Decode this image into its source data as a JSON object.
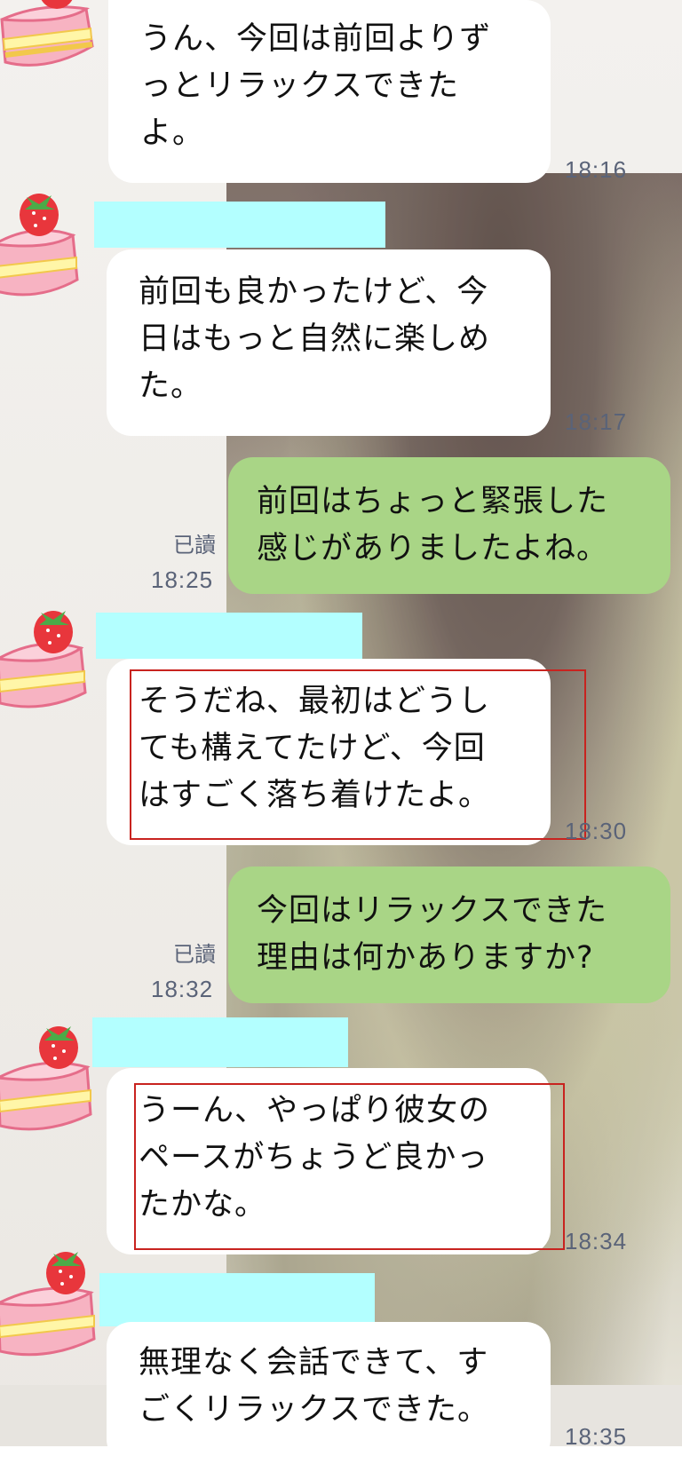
{
  "chat": {
    "messages": [
      {
        "side": "left",
        "lines": [
          "うん、今回は前回よりず",
          "っとリラックスできた",
          "よ。"
        ],
        "time": "18:16"
      },
      {
        "side": "left",
        "lines": [
          "前回も良かったけど、今",
          "日はもっと自然に楽しめ",
          "た。"
        ],
        "time": "18:17"
      },
      {
        "side": "right",
        "lines": [
          "前回はちょっと緊張した",
          "感じがありましたよね。"
        ],
        "read": "已讀",
        "time": "18:25"
      },
      {
        "side": "left",
        "lines": [
          "そうだね、最初はどうし",
          "ても構えてたけど、今回",
          "はすごく落ち着けたよ。"
        ],
        "time": "18:30",
        "highlighted": true
      },
      {
        "side": "right",
        "lines": [
          "今回はリラックスできた",
          "理由は何かありますか?"
        ],
        "read": "已讀",
        "time": "18:32"
      },
      {
        "side": "left",
        "lines": [
          "うーん、やっぱり彼女の",
          "ペースがちょうど良かっ",
          "たかな。"
        ],
        "time": "18:34",
        "highlighted": true
      },
      {
        "side": "left",
        "lines": [
          "無理なく会話できて、す",
          "ごくリラックスできた。"
        ],
        "time": "18:35"
      }
    ]
  },
  "colors": {
    "bubble_left": "#ffffff",
    "bubble_right": "#a9d586",
    "name_mask": "#b3ffff",
    "highlight_border": "#c8231f",
    "meta_text": "#5a6378"
  },
  "icons": {
    "avatar": "strawberry-cake-icon"
  }
}
